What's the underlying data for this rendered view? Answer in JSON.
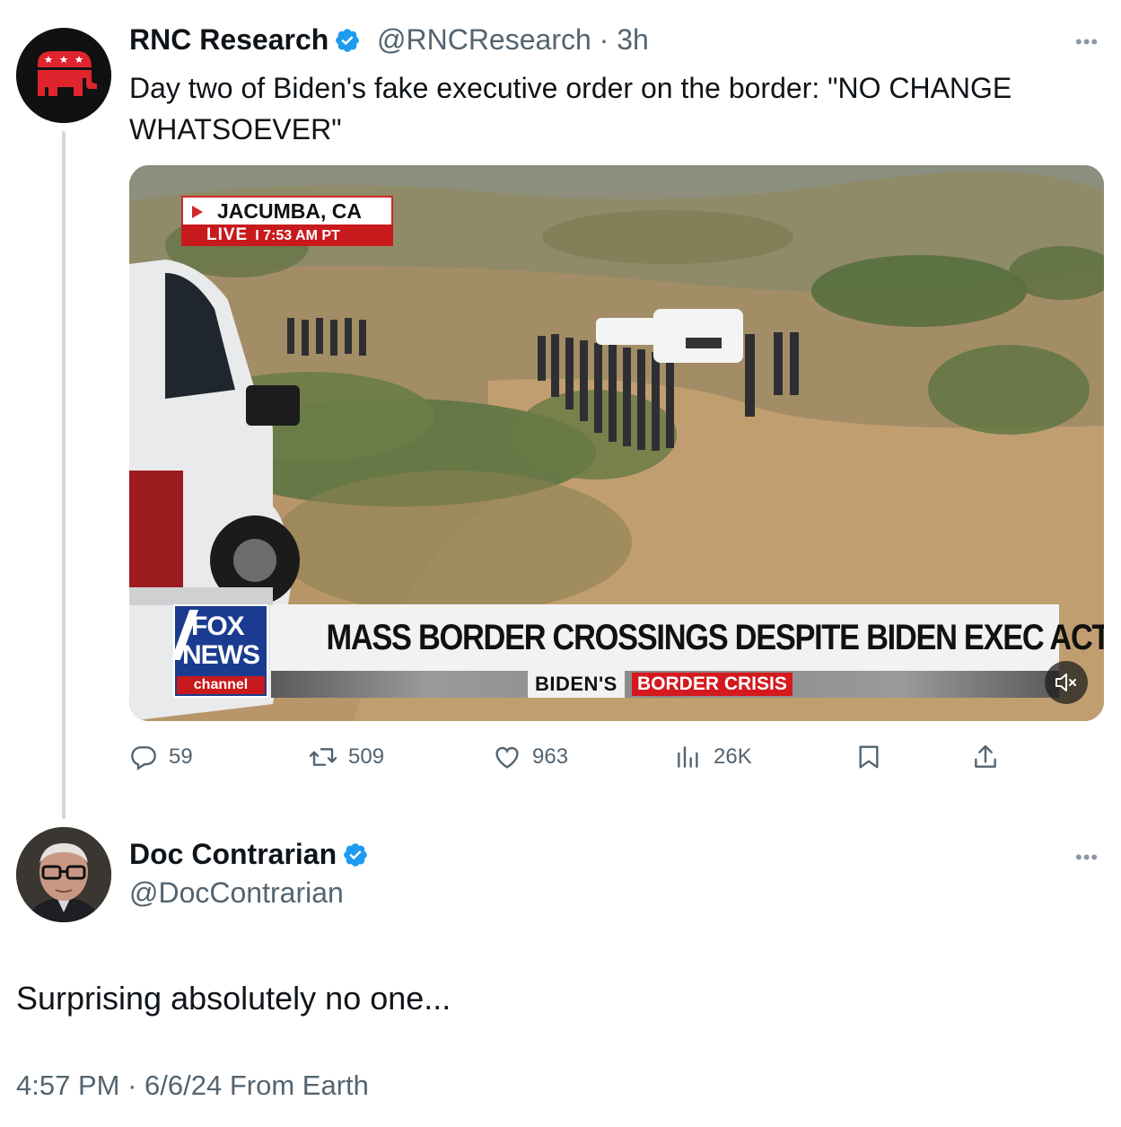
{
  "parent_tweet": {
    "author_name": "RNC Research",
    "handle": "@RNCResearch",
    "separator": "·",
    "age": "3h",
    "text": "Day two of Biden's fake executive order on the border: \"NO CHANGE WHATSOEVER\"",
    "media": {
      "location": "JACUMBA, CA",
      "live_label": "LIVE",
      "live_sep": "I",
      "time": "7:53 AM PT",
      "network_logo_top": "FOX",
      "network_logo_mid": "NEWS",
      "network_logo_bottom": "channel",
      "headline": "MASS BORDER CROSSINGS DESPITE BIDEN EXEC ACTIONS",
      "subhead_part1": "BIDEN'S",
      "subhead_part2": "BORDER CRISIS"
    },
    "stats": {
      "replies": "59",
      "reposts": "509",
      "likes": "963",
      "views": "26K"
    }
  },
  "reply_tweet": {
    "author_name": "Doc Contrarian",
    "handle": "@DocContrarian",
    "text": "Surprising absolutely no one...",
    "time": "4:57 PM",
    "separator": "·",
    "date": "6/6/24",
    "source": "From Earth"
  },
  "colors": {
    "verified_blue": "#1d9bf0",
    "secondary_text": "#536471",
    "thread_line": "#cfd9de",
    "rnc_red": "#e0242d"
  },
  "icons": [
    "more-icon",
    "verified-icon",
    "reply-icon",
    "repost-icon",
    "like-icon",
    "views-icon",
    "bookmark-icon",
    "share-icon",
    "mute-icon"
  ]
}
